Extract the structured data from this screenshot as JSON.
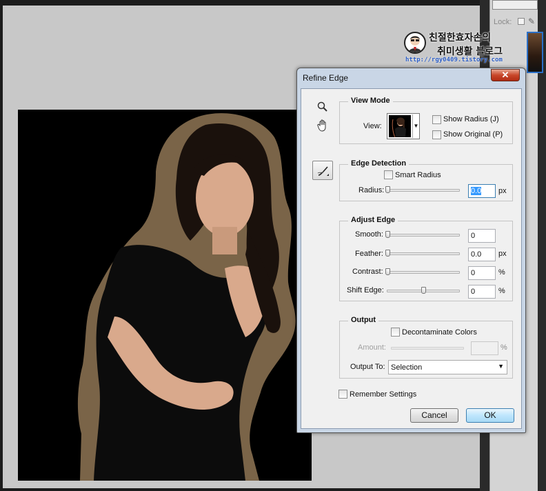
{
  "watermark": {
    "line1": "친절한효자손의",
    "line2": "취미생활 블로그",
    "url": "http://rgy0409.tistory.com"
  },
  "layers_panel": {
    "lock_label": "Lock:"
  },
  "dialog": {
    "title": "Refine Edge",
    "close_glyph": "✕",
    "view_mode": {
      "title": "View Mode",
      "view_label": "View:",
      "show_radius": "Show Radius (J)",
      "show_original": "Show Original (P)"
    },
    "edge_detection": {
      "title": "Edge Detection",
      "smart_radius": "Smart Radius",
      "radius_label": "Radius:",
      "radius_value": "0.0",
      "radius_unit": "px"
    },
    "adjust_edge": {
      "title": "Adjust Edge",
      "smooth_label": "Smooth:",
      "smooth_value": "0",
      "feather_label": "Feather:",
      "feather_value": "0.0",
      "feather_unit": "px",
      "contrast_label": "Contrast:",
      "contrast_value": "0",
      "contrast_unit": "%",
      "shift_label": "Shift Edge:",
      "shift_value": "0",
      "shift_unit": "%"
    },
    "output": {
      "title": "Output",
      "decontaminate": "Decontaminate Colors",
      "amount_label": "Amount:",
      "amount_unit": "%",
      "output_to_label": "Output To:",
      "output_to_value": "Selection"
    },
    "remember": "Remember Settings",
    "cancel": "Cancel",
    "ok": "OK"
  },
  "colors": {
    "canvas_background": "#000000",
    "edge_halo": "#7a6448",
    "dialog_frame": "#c9d6e6",
    "selection_highlight": "#3399ff"
  },
  "icons": {
    "zoom": "magnifier-icon",
    "hand": "hand-icon",
    "refine_radius": "refine-radius-brush-icon",
    "close": "close-icon",
    "dropdown": "chevron-down-icon"
  }
}
